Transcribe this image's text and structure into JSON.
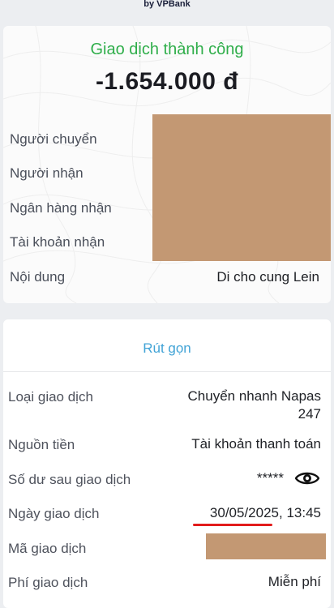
{
  "brand": {
    "text": "by VPBank"
  },
  "result": {
    "status": "Giao dịch thành công",
    "amount": "-1.654.000 đ"
  },
  "summary_rows": [
    {
      "label": "Người chuyển",
      "value": ""
    },
    {
      "label": "Người nhận",
      "value": ""
    },
    {
      "label": "Ngân hàng nhận",
      "value": ""
    },
    {
      "label": "Tài khoản nhận",
      "value": ""
    },
    {
      "label": "Nội dung",
      "value": "Di cho cung Lein"
    }
  ],
  "details": {
    "collapse_label": "Rút gọn",
    "rows": [
      {
        "label": "Loại giao dịch",
        "value_line1": "Chuyển nhanh Napas",
        "value_line2": "247"
      },
      {
        "label": "Nguồn tiền",
        "value": "Tài khoản thanh toán"
      },
      {
        "label": "Số dư sau giao dịch",
        "value": "*****"
      },
      {
        "label": "Ngày giao dịch",
        "value": "30/05/2025, 13:45"
      },
      {
        "label": "Mã giao dịch",
        "value": ""
      },
      {
        "label": "Phí giao dịch",
        "value": "Miễn phí"
      }
    ]
  },
  "colors": {
    "success": "#2fae4a",
    "link": "#41a3d6",
    "highlight": "#e21b1b",
    "redaction": "#c39873"
  },
  "icons": {
    "balance_toggle": "eye-icon"
  }
}
